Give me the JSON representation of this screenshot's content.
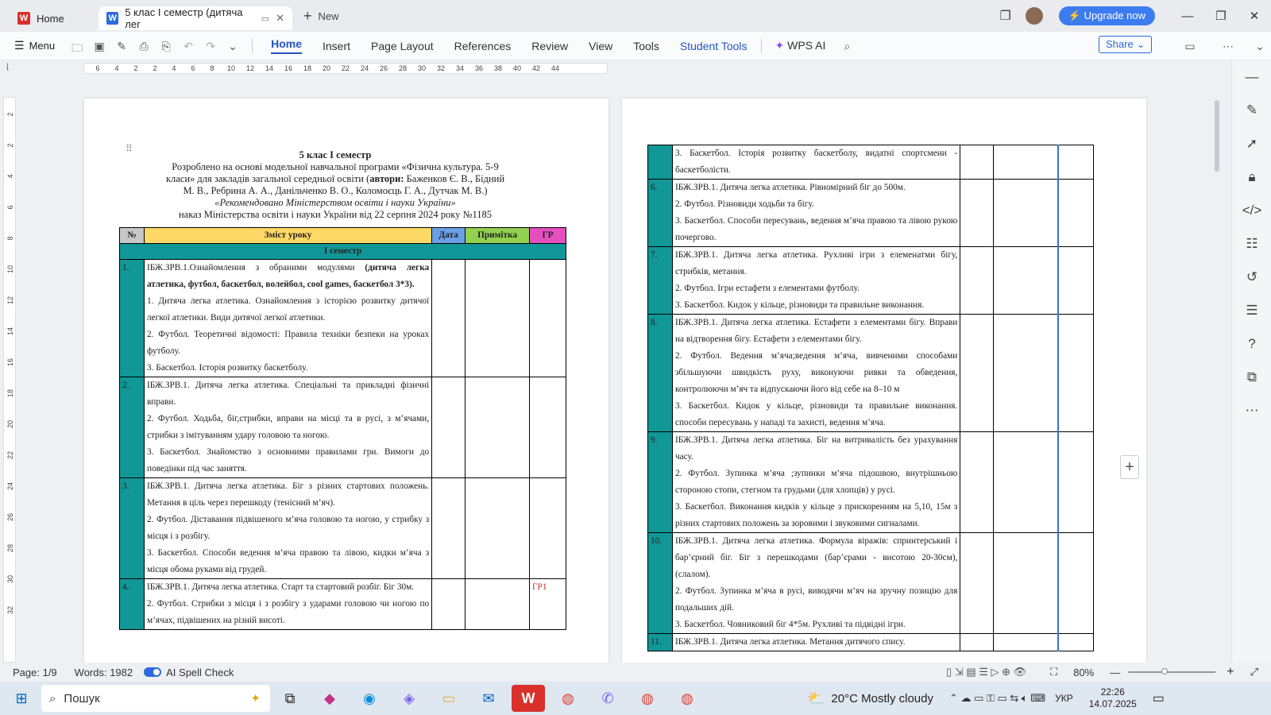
{
  "titlebar": {
    "home_tab": "Home",
    "doc_tab": "5 клас І семестр (дитяча лег",
    "new_tab": "New",
    "upgrade": "Upgrade now"
  },
  "ribbon": {
    "menu": "Menu",
    "tabs": [
      "Home",
      "Insert",
      "Page Layout",
      "References",
      "Review",
      "View",
      "Tools",
      "Student Tools",
      "WPS AI"
    ],
    "share": "Share"
  },
  "ruler": {
    "h": [
      "6",
      "4",
      "2",
      "2",
      "4",
      "6",
      "8",
      "10",
      "12",
      "14",
      "16",
      "18",
      "20",
      "22",
      "24",
      "26",
      "28",
      "30",
      "32",
      "34",
      "36",
      "38",
      "40",
      "42",
      "44"
    ],
    "v": [
      "2",
      "2",
      "4",
      "6",
      "8",
      "10",
      "12",
      "14",
      "16",
      "18",
      "20",
      "22",
      "24",
      "26",
      "28",
      "30",
      "32"
    ]
  },
  "doc": {
    "title": "5 клас І семестр",
    "line2": "Розроблено на основі модельної навчальної програми «Фізична культура. 5-9 класи» для закладів загальної середньої освіти (",
    "authors_label": "автори:",
    "authors": " Баженков Є. В.,  Бідний М. В., Ребрина А. А., Данільченко В. О., Коломоєць Г. А., Дутчак М. В.)",
    "recommended": "«Рекомендовано Міністерством освіти і науки України»",
    "order": "наказ Міністерства освіти і науки України від 22 серпня 2024 року №1185",
    "headers": {
      "num": "№",
      "content": "Зміст уроку",
      "date": "Дата",
      "note": "Примітка",
      "gr": "ГР"
    },
    "semester": "І семестр",
    "page1_rows": [
      {
        "n": "1.",
        "gr": "",
        "lead": "ІБЖ.ЗРВ.1.Ознайомлення з обраними модулями ",
        "bold": "(дитяча легка атлетика,  футбол,  баскетбол, волейбол, cool games, баскетбол 3*3).",
        "lines": [
          "1. Дитяча легка атлетика. Ознайомлення з історією розвитку дитячої легкої атлетики. Види дитячої легкої атлетики.",
          "2. Футбол. Теоретичні відомості: Правила техніки безпеки на уроках футболу.",
          "3. Баскетбол. Історія розвитку баскетболу."
        ]
      },
      {
        "n": "2.",
        "gr": "",
        "lead": "ІБЖ.ЗРВ.1. Дитяча легка атлетика. Спеціальні та прикладні фізичні вправи.",
        "bold": "",
        "lines": [
          "2. Футбол. Ходьба, біг,стрибки, вправи на місці та в русі, з м’ячами, стрибки з імітуванням удару головою та ногою.",
          "3. Баскетбол. Знайомство з основними правилами гри. Вимоги до поведінки під час заняття."
        ]
      },
      {
        "n": "3.",
        "gr": "",
        "lead": "ІБЖ.ЗРВ.1. Дитяча легка атлетика. Біг з різних стартових положень. Метання в ціль через перешкоду (тенісний м’яч).",
        "bold": "",
        "lines": [
          "2. Футбол. Діставання підвішеного м’яча головою та ногою, у стрибку з місця і з розбігу.",
          "3. Баскетбол. Способи  ведення м’яча правою та лівою, кидки м’яча з місця обома руками від грудей."
        ]
      },
      {
        "n": "4.",
        "gr": "ГР1",
        "lead": "ІБЖ.ЗРВ.1. Дитяча легка атлетика. Старт та стартовий розбіг. Біг 30м.",
        "bold": "",
        "lines": [
          "2. Футбол. Стрибки з місця і з розбігу з ударами головою чи ногою по м’ячах, підвішених на різній висоті."
        ]
      }
    ],
    "page2_rows": [
      {
        "n": "",
        "text": [
          "3. Баскетбол. Історія розвитку баскетболу, видатні спортсмени - баскетболісти."
        ]
      },
      {
        "n": "6.",
        "text": [
          "ІБЖ.ЗРВ.1. Дитяча легка атлетика. Рівномірний біг до 500м.",
          "2.  Футбол. Різновиди ходьби та бігу.",
          "3. Баскетбол. Способи пересувань, ведення м’яча правою та лівою рукою почергово."
        ]
      },
      {
        "n": "7.",
        "text": [
          "ІБЖ.ЗРВ.1. Дитяча легка атлетика. Рухливі ігри з елеменатми бігу, стрибків, метання.",
          "2. Футбол. Ігри естафети з елементами футболу.",
          "3. Баскетбол. Кидок  у кільце, різновиди та правильне виконання."
        ]
      },
      {
        "n": "8.",
        "text": [
          "ІБЖ.ЗРВ.1. Дитяча легка атлетика. Естафети з елементами бігу. Вправи на відтворення бігу.  Естафети з елементами бігу.",
          "2. Футбол. Ведення м’яча;ведення м’яча, вивченими способами збільшуючи швидкість руху, виконуючи ривки та обведення, контролюючи м’яч та відпускаючи його від себе на 8–10 м",
          "3. Баскетбол. Кидок у кільце, різновиди та правильне виконання. способи пересувань у нападі та захисті, ведення м’яча."
        ]
      },
      {
        "n": "9.",
        "text": [
          "ІБЖ.ЗРВ.1.  Дитяча  легка  атлетика.  Біг  на  витривалість  без урахування часу.",
          "2. Футбол. Зупинка м’яча ;зупинки м’яча підошвою, внутрішньою стороною стопи, стегном та грудьми (для хлопців) у русі.",
          "3. Баскетбол. Виконання кидків у кільце з прискоренням на 5,10, 15м з різних стартових положень за зоровими і звуковими сигналами."
        ]
      },
      {
        "n": "10.",
        "text": [
          "ІБЖ.ЗРВ.1. Дитяча легка атлетика. Формула віражів: спринтерський і бар’єрний біг. Біг з перешкодами (бар’єрами - висотою 20-30см), (слалом).",
          "2. Футбол. Зупинка м’яча в русі, виводячи м’яч на зручну позицію для подальших дій.",
          "3. Баскетбол. Човниковий біг 4*5м. Рухливі та підвідні ігри."
        ]
      },
      {
        "n": "11.",
        "text": [
          "ІБЖ.ЗРВ.1. Дитяча легка атлетика. Метання дитячого спису."
        ]
      }
    ]
  },
  "status": {
    "page": "Page: 1/9",
    "words": "Words: 1982",
    "spell": "AI Spell Check",
    "zoom": "80%"
  },
  "taskbar": {
    "search": "Пошук",
    "weather": "20°C  Mostly cloudy",
    "lang": "УКР",
    "time": "22:26",
    "date": "14.07.2025"
  },
  "colors": {
    "teal": "#119797",
    "header_gray": "#c8c8c8",
    "header_yellow": "#ffd966",
    "date_blue": "#6aa0e8",
    "note_green": "#92d050",
    "gr_pink": "#e64fc0",
    "accent": "#3c7cf0"
  }
}
